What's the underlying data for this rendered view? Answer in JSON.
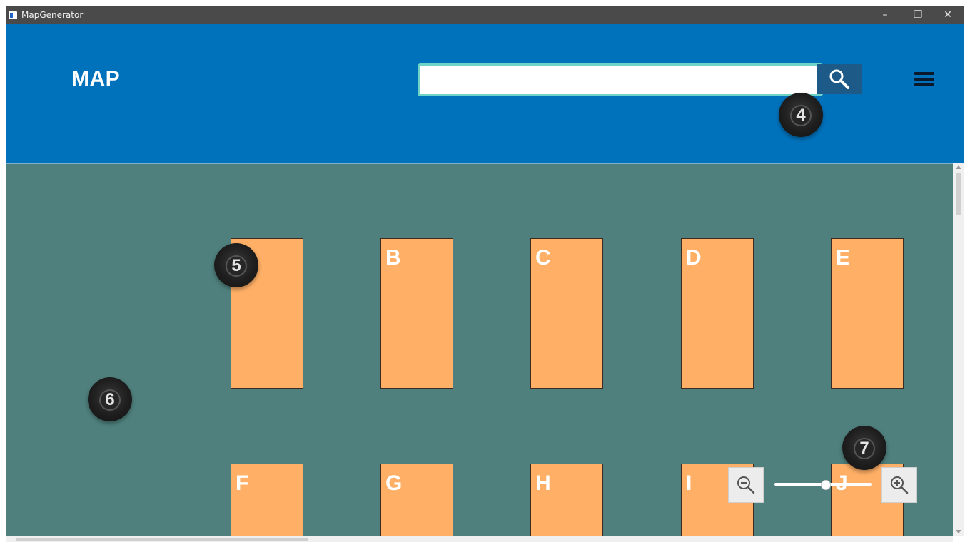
{
  "window": {
    "title": "MapGenerator",
    "minimize_icon": "–",
    "maximize_icon": "❐",
    "close_icon": "✕"
  },
  "header": {
    "title": "MAP",
    "search": {
      "value": "",
      "placeholder": ""
    },
    "search_icon": "search-icon",
    "menu_icon": "hamburger-menu-icon"
  },
  "map": {
    "blocks_row1": [
      "",
      "B",
      "C",
      "D",
      "E"
    ],
    "blocks_row2": [
      "F",
      "G",
      "H",
      "I",
      "J"
    ]
  },
  "markers": [
    "4",
    "5",
    "6",
    "7"
  ],
  "zoom": {
    "zoom_out_icon": "zoom-out-icon",
    "zoom_in_icon": "zoom-in-icon",
    "level": 0.52
  },
  "colors": {
    "header": "#0072bc",
    "map_background": "#4f807d",
    "block": "#ffb066",
    "search_border": "#6fd3c7",
    "search_button": "#1d5a87"
  }
}
